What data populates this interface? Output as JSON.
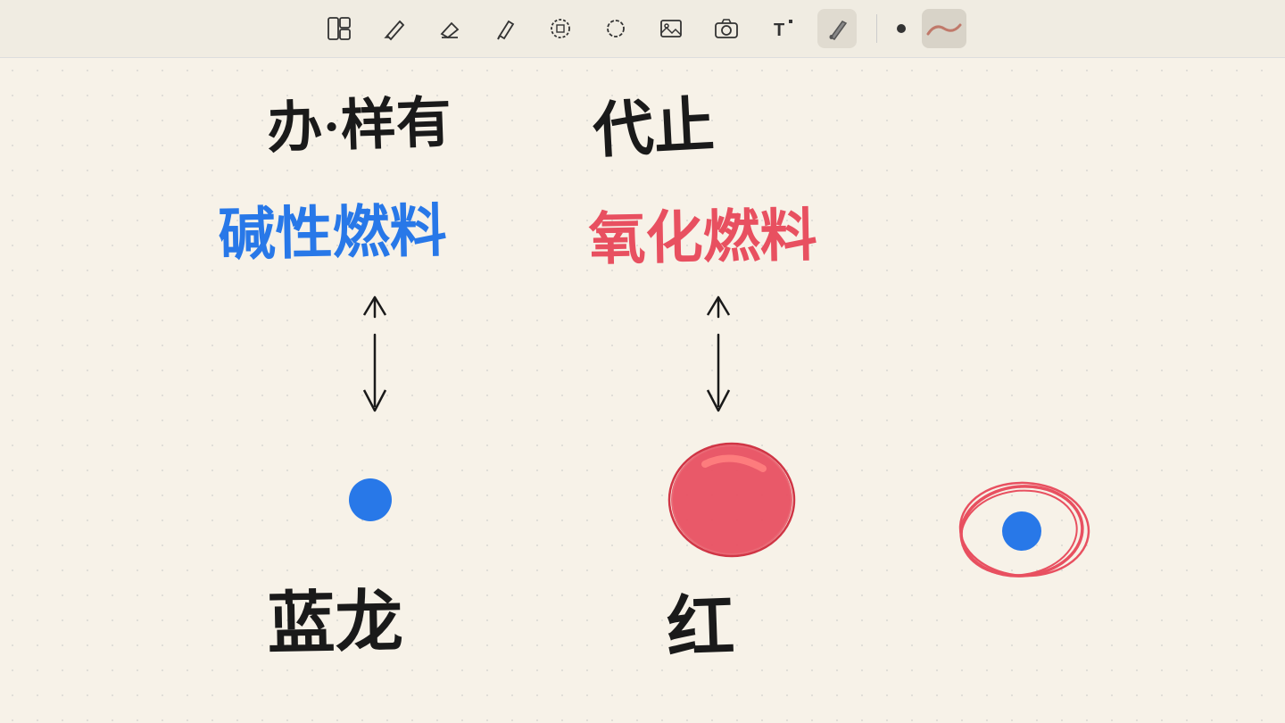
{
  "toolbar": {
    "tools": [
      {
        "name": "panel-icon",
        "label": "⊞",
        "active": false
      },
      {
        "name": "pencil-icon",
        "label": "✏",
        "active": false
      },
      {
        "name": "eraser-icon",
        "label": "◇",
        "active": false
      },
      {
        "name": "highlighter-icon",
        "label": "✒",
        "active": false
      },
      {
        "name": "shapes-icon",
        "label": "⬡",
        "active": false
      },
      {
        "name": "lasso-icon",
        "label": "◌",
        "active": false
      },
      {
        "name": "image-icon",
        "label": "⊡",
        "active": false
      },
      {
        "name": "camera-icon",
        "label": "⊙",
        "active": false
      },
      {
        "name": "text-icon",
        "label": "T",
        "active": false
      },
      {
        "name": "marker-icon",
        "label": "▬",
        "active": false
      }
    ]
  },
  "canvas": {
    "background_color": "#f7f2e8"
  }
}
